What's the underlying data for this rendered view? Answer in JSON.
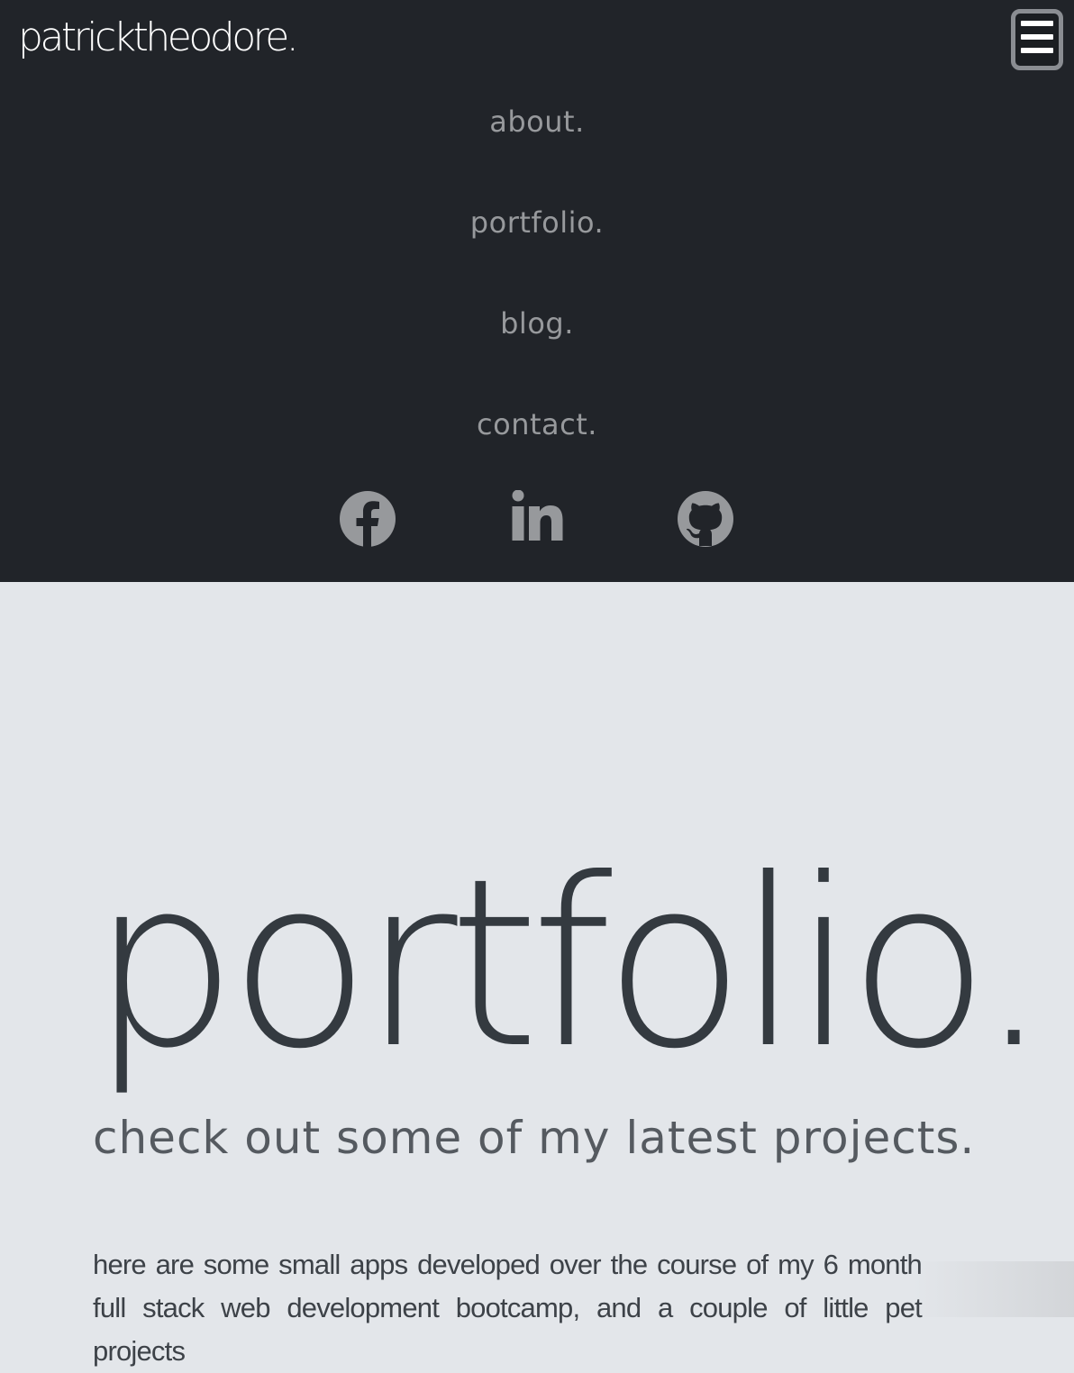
{
  "header": {
    "brand": "patricktheodore.",
    "menu_icon": "hamburger-menu-icon"
  },
  "menu": {
    "items": [
      {
        "label": "about."
      },
      {
        "label": "portfolio."
      },
      {
        "label": "blog."
      },
      {
        "label": "contact."
      }
    ]
  },
  "social": [
    {
      "icon": "facebook-icon"
    },
    {
      "icon": "linkedin-icon"
    },
    {
      "icon": "github-icon"
    }
  ],
  "main": {
    "title": "portfolio.",
    "subtitle": "check out some of my latest projects.",
    "intro": "here are some small apps developed over the course of my 6 month full stack web development bootcamp, and a couple of little pet projects"
  },
  "colors": {
    "nav_bg": "#212429",
    "page_bg": "#e3e6ea",
    "menu_text": "#97999c",
    "title_text": "#343a40"
  }
}
